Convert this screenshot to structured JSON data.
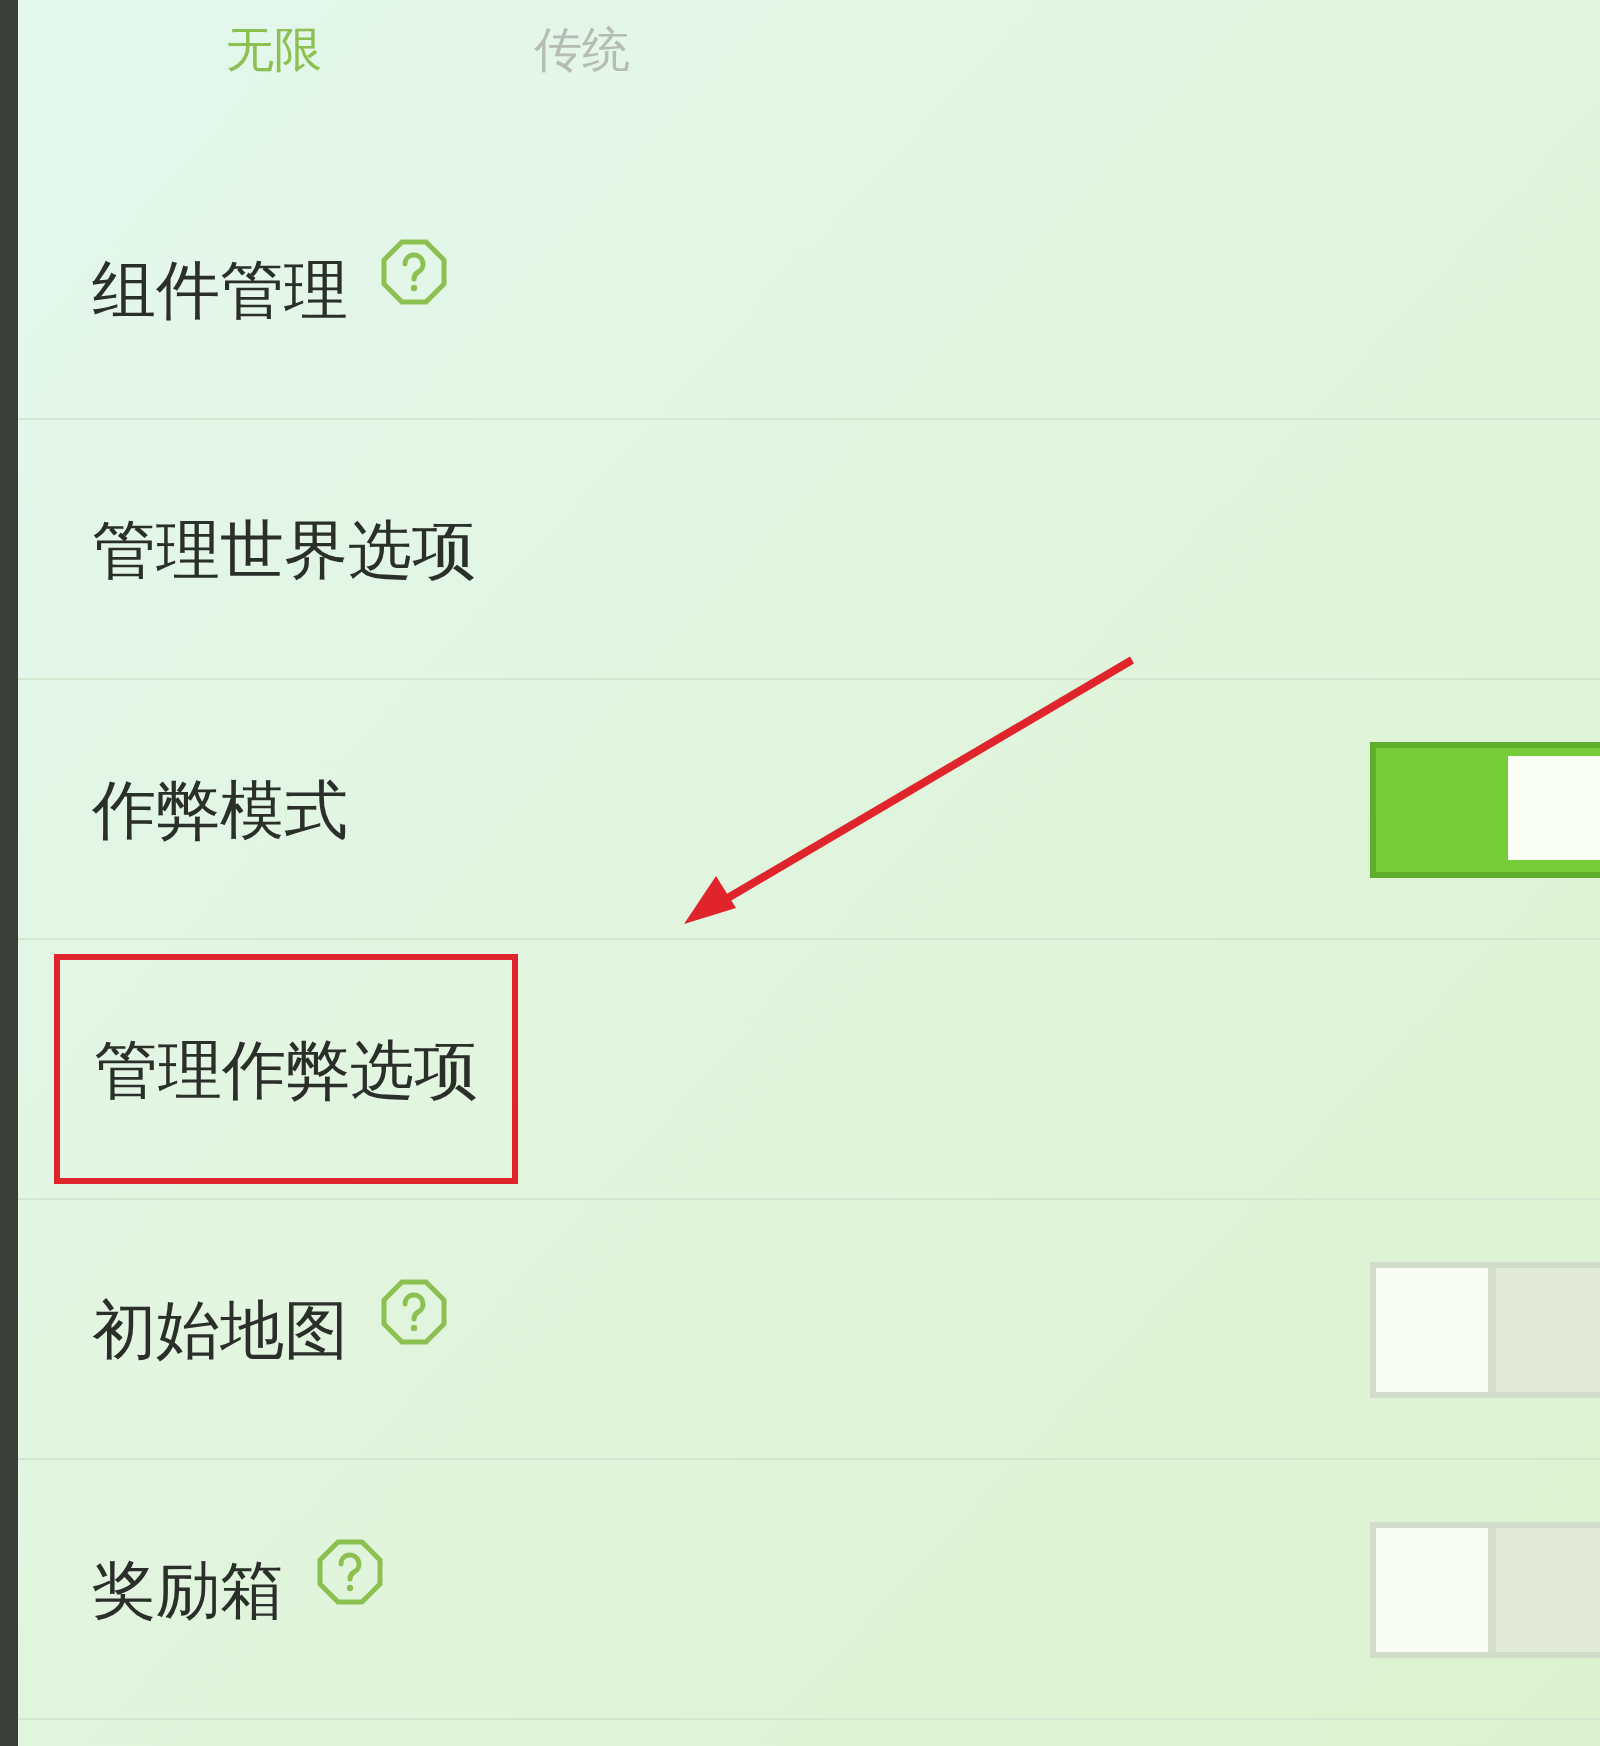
{
  "tabs": [
    {
      "label": "无限",
      "selected": true
    },
    {
      "label": "传统",
      "selected": false
    }
  ],
  "rows": [
    {
      "kind": "link",
      "label": "组件管理",
      "help": true,
      "highlighted": false
    },
    {
      "kind": "link",
      "label": "管理世界选项",
      "help": false,
      "highlighted": false
    },
    {
      "kind": "toggle",
      "label": "作弊模式",
      "help": false,
      "highlighted": false,
      "on": true
    },
    {
      "kind": "link",
      "label": "管理作弊选项",
      "help": false,
      "highlighted": true
    },
    {
      "kind": "toggle",
      "label": "初始地图",
      "help": true,
      "highlighted": false,
      "on": false
    },
    {
      "kind": "toggle",
      "label": "奖励箱",
      "help": true,
      "highlighted": false,
      "on": false
    }
  ]
}
